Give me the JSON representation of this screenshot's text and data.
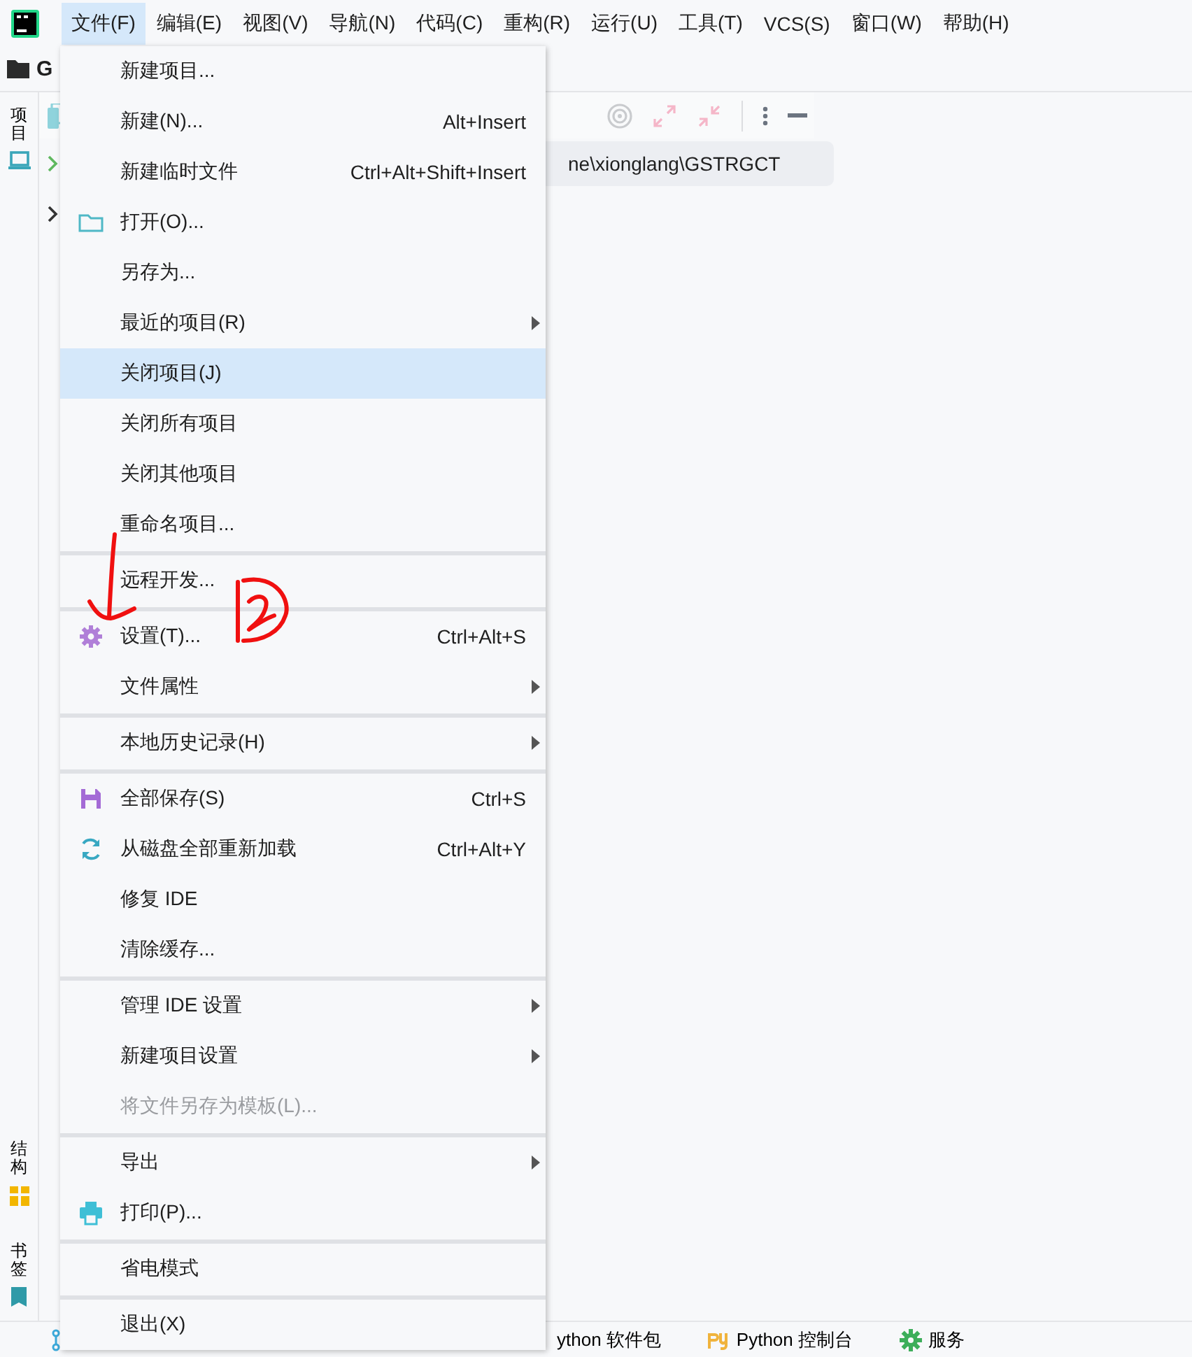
{
  "menubar": {
    "items": [
      {
        "label": "文件(F)",
        "selected": true
      },
      {
        "label": "编辑(E)",
        "selected": false
      },
      {
        "label": "视图(V)",
        "selected": false
      },
      {
        "label": "导航(N)",
        "selected": false
      },
      {
        "label": "代码(C)",
        "selected": false
      },
      {
        "label": "重构(R)",
        "selected": false
      },
      {
        "label": "运行(U)",
        "selected": false
      },
      {
        "label": "工具(T)",
        "selected": false
      },
      {
        "label": "VCS(S)",
        "selected": false
      },
      {
        "label": "窗口(W)",
        "selected": false
      },
      {
        "label": "帮助(H)",
        "selected": false
      }
    ]
  },
  "project_title": "G",
  "tool_strip": {
    "top": [
      {
        "label": "项目",
        "kind": "laptop"
      }
    ],
    "bottom": [
      {
        "label": "结构",
        "kind": "structure"
      },
      {
        "label": "书签",
        "kind": "bookmark"
      }
    ]
  },
  "project_panel": {
    "path": "ne\\xionglang\\GSTRGCT"
  },
  "file_menu": {
    "groups": [
      [
        {
          "label": "新建项目...",
          "selected": false,
          "disabled": false,
          "submenu": false
        },
        {
          "label": "新建(N)...",
          "shortcut": "Alt+Insert",
          "selected": false,
          "disabled": false,
          "submenu": false
        },
        {
          "label": "新建临时文件",
          "shortcut": "Ctrl+Alt+Shift+Insert",
          "selected": false,
          "disabled": false,
          "submenu": false
        },
        {
          "label": "打开(O)...",
          "kind": "folder",
          "selected": false,
          "disabled": false,
          "submenu": false
        },
        {
          "label": "另存为...",
          "selected": false,
          "disabled": false,
          "submenu": false
        },
        {
          "label": "最近的项目(R)",
          "selected": false,
          "disabled": false,
          "submenu": true
        },
        {
          "label": "关闭项目(J)",
          "selected": true,
          "disabled": false,
          "submenu": false
        },
        {
          "label": "关闭所有项目",
          "selected": false,
          "disabled": false,
          "submenu": false
        },
        {
          "label": "关闭其他项目",
          "selected": false,
          "disabled": false,
          "submenu": false
        },
        {
          "label": "重命名项目...",
          "selected": false,
          "disabled": false,
          "submenu": false
        }
      ],
      [
        {
          "label": "远程开发...",
          "selected": false,
          "disabled": false,
          "submenu": false
        }
      ],
      [
        {
          "label": "设置(T)...",
          "shortcut": "Ctrl+Alt+S",
          "kind": "gear",
          "selected": false,
          "disabled": false,
          "submenu": false
        },
        {
          "label": "文件属性",
          "selected": false,
          "disabled": false,
          "submenu": true
        }
      ],
      [
        {
          "label": "本地历史记录(H)",
          "selected": false,
          "disabled": false,
          "submenu": true
        }
      ],
      [
        {
          "label": "全部保存(S)",
          "shortcut": "Ctrl+S",
          "kind": "save",
          "selected": false,
          "disabled": false,
          "submenu": false
        },
        {
          "label": "从磁盘全部重新加载",
          "shortcut": "Ctrl+Alt+Y",
          "kind": "reload",
          "selected": false,
          "disabled": false,
          "submenu": false
        },
        {
          "label": "修复 IDE",
          "selected": false,
          "disabled": false,
          "submenu": false
        },
        {
          "label": "清除缓存...",
          "selected": false,
          "disabled": false,
          "submenu": false
        }
      ],
      [
        {
          "label": "管理 IDE 设置",
          "selected": false,
          "disabled": false,
          "submenu": true
        },
        {
          "label": "新建项目设置",
          "selected": false,
          "disabled": false,
          "submenu": true
        },
        {
          "label": "将文件另存为模板(L)...",
          "selected": false,
          "disabled": true,
          "submenu": false
        }
      ],
      [
        {
          "label": "导出",
          "selected": false,
          "disabled": false,
          "submenu": true
        },
        {
          "label": "打印(P)...",
          "kind": "printer",
          "selected": false,
          "disabled": false,
          "submenu": false
        }
      ],
      [
        {
          "label": "省电模式",
          "selected": false,
          "disabled": false,
          "submenu": false
        }
      ],
      [
        {
          "label": "退出(X)",
          "selected": false,
          "disabled": false,
          "submenu": false
        }
      ]
    ]
  },
  "status_bar": {
    "items": [
      {
        "label": "ython 软件包"
      },
      {
        "label": "Python 控制台",
        "kind": "python"
      },
      {
        "label": "服务",
        "kind": "services"
      }
    ]
  }
}
